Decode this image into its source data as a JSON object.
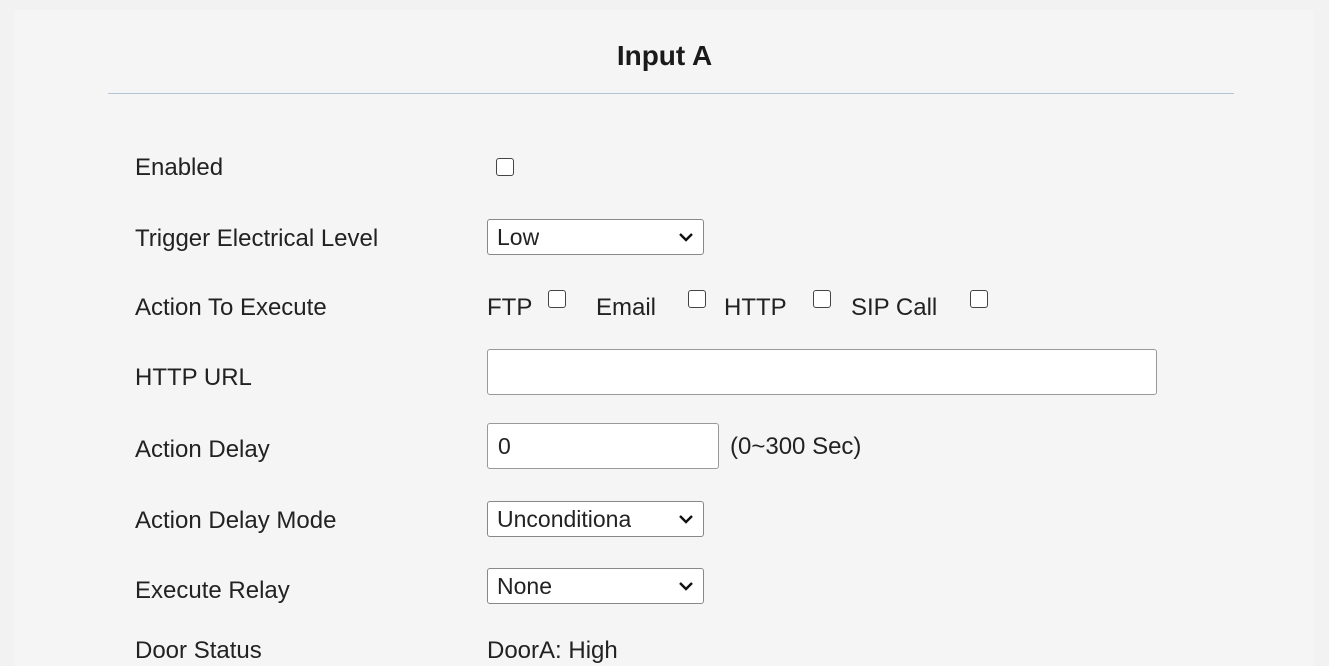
{
  "title": "Input A",
  "fields": {
    "enabled_label": "Enabled",
    "trigger_label": "Trigger Electrical Level",
    "trigger_value": "Low",
    "action_label": "Action To Execute",
    "action_ftp": "FTP",
    "action_email": "Email",
    "action_http": "HTTP",
    "action_sip": "SIP Call",
    "http_url_label": "HTTP URL",
    "http_url_value": "",
    "delay_label": "Action Delay",
    "delay_value": "0",
    "delay_hint": "(0~300 Sec)",
    "delay_mode_label": "Action Delay Mode",
    "delay_mode_value": "Unconditiona",
    "relay_label": "Execute Relay",
    "relay_value": "None",
    "door_status_label": "Door Status",
    "door_status_value": "DoorA: High"
  },
  "icons": {
    "dropdown": "chevron-down-icon",
    "checkbox": "checkbox-unchecked"
  }
}
